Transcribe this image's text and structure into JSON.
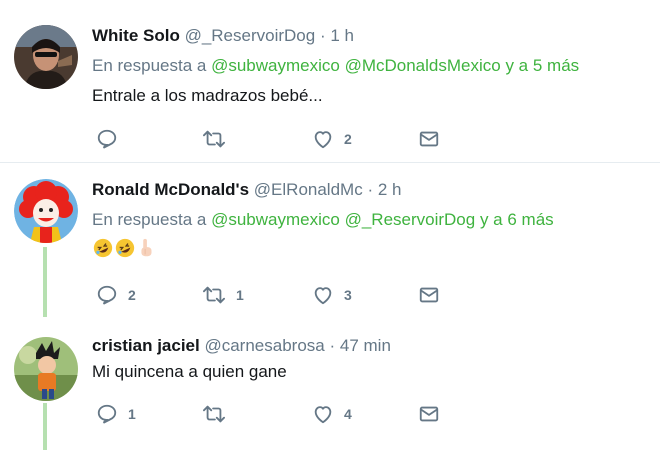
{
  "tweets": [
    {
      "name": "White Solo",
      "handle": "@_ReservoirDog",
      "sep": "·",
      "time": "1 h",
      "reply_prefix": "En respuesta a",
      "mentions": [
        "@subwaymexico",
        "@McDonaldsMexico"
      ],
      "reply_suffix": "y a 5 más",
      "text": "Entrale a los madrazos bebé...",
      "reply_count": "",
      "retweet_count": "",
      "like_count": "2"
    },
    {
      "name": "Ronald McDonald's",
      "handle": "@ElRonaldMc",
      "sep": "·",
      "time": "2 h",
      "reply_prefix": "En respuesta a",
      "mentions": [
        "@subwaymexico",
        "@_ReservoirDog"
      ],
      "reply_suffix": "y a 6 más",
      "emojis": [
        "rolling-on-floor-laughing",
        "rolling-on-floor-laughing",
        "pointing-up-hand"
      ],
      "reply_count": "2",
      "retweet_count": "1",
      "like_count": "3"
    },
    {
      "name": "cristian jaciel",
      "handle": "@carnesabrosa",
      "sep": "·",
      "time": "47 min",
      "text": "Mi quincena a quien gane",
      "reply_count": "1",
      "retweet_count": "",
      "like_count": "4"
    }
  ],
  "colors": {
    "mention": "#3fb33f",
    "muted": "#657786",
    "thread_line": "#b6e0b0"
  },
  "icons": [
    "reply-icon",
    "retweet-icon",
    "like-icon",
    "dm-icon"
  ]
}
